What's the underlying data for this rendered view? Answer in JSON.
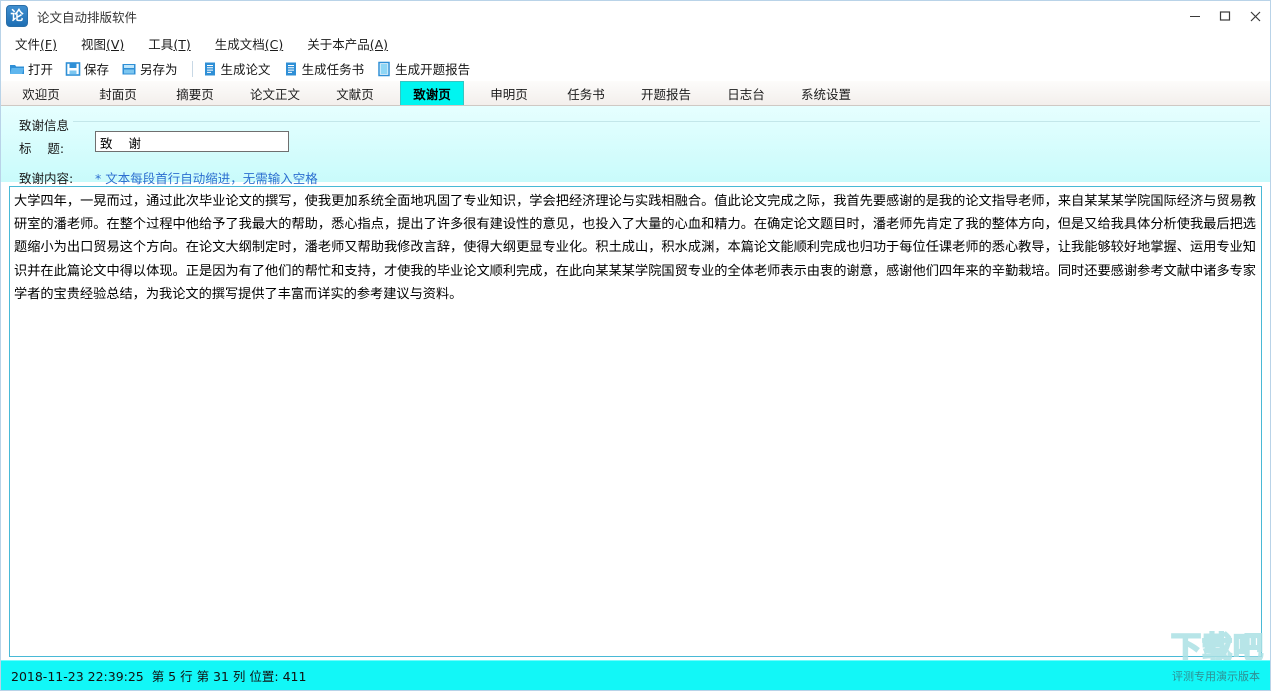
{
  "window": {
    "title": "论文自动排版软件",
    "icon": "app-logo-icon",
    "icon_glyph": "论",
    "controls": {
      "minimize": "minimize-icon",
      "maximize": "maximize-icon",
      "close": "close-icon"
    }
  },
  "menubar": {
    "items": [
      {
        "label": "文件(F)",
        "text": "文件",
        "mnemonic": "(F)"
      },
      {
        "label": "视图(V)",
        "text": "视图",
        "mnemonic": "(V)"
      },
      {
        "label": "工具(T)",
        "text": "工具",
        "mnemonic": "(T)"
      },
      {
        "label": "生成文档(C)",
        "text": "生成文档",
        "mnemonic": "(C)"
      },
      {
        "label": "关于本产品(A)",
        "text": "关于本产品",
        "mnemonic": "(A)"
      }
    ]
  },
  "toolbar": {
    "items": [
      {
        "label": "打开",
        "icon": "folder-open-icon"
      },
      {
        "label": "保存",
        "icon": "save-disk-icon"
      },
      {
        "label": "另存为",
        "icon": "save-as-icon"
      },
      {
        "label": "生成论文",
        "icon": "document-thesis-icon"
      },
      {
        "label": "生成任务书",
        "icon": "document-task-icon"
      },
      {
        "label": "生成开题报告",
        "icon": "document-report-icon"
      }
    ]
  },
  "tabs": {
    "active_index": 5,
    "items": [
      {
        "label": "欢迎页"
      },
      {
        "label": "封面页"
      },
      {
        "label": "摘要页"
      },
      {
        "label": "论文正文"
      },
      {
        "label": "文献页"
      },
      {
        "label": "致谢页"
      },
      {
        "label": "申明页"
      },
      {
        "label": "任务书"
      },
      {
        "label": "开题报告"
      },
      {
        "label": "日志台"
      },
      {
        "label": "系统设置"
      }
    ]
  },
  "form": {
    "group_label": "致谢信息",
    "title_label": "标    题:",
    "title_value": "致    谢",
    "title_placeholder": "",
    "content_label": "致谢内容:",
    "hint": "* 文本每段首行自动缩进，无需输入空格"
  },
  "editor": {
    "content": "大学四年，一晃而过，通过此次毕业论文的撰写，使我更加系统全面地巩固了专业知识，学会把经济理论与实践相融合。值此论文完成之际，我首先要感谢的是我的论文指导老师，来自某某某学院国际经济与贸易教研室的潘老师。在整个过程中他给予了我最大的帮助，悉心指点，提出了许多很有建设性的意见，也投入了大量的心血和精力。在确定论文题目时，潘老师先肯定了我的整体方向，但是又给我具体分析使我最后把选题缩小为出口贸易这个方向。在论文大纲制定时，潘老师又帮助我修改言辞，使得大纲更显专业化。积土成山，积水成渊，本篇论文能顺利完成也归功于每位任课老师的悉心教导，让我能够较好地掌握、运用专业知识并在此篇论文中得以体现。正是因为有了他们的帮忙和支持，才使我的毕业论文顺利完成，在此向某某某学院国贸专业的全体老师表示由衷的谢意，感谢他们四年来的辛勤栽培。同时还要感谢参考文献中诸多专家学者的宝贵经验总结，为我论文的撰写提供了丰富而详实的参考建议与资料。"
  },
  "statusbar": {
    "timestamp": "2018-11-23 22:39:25",
    "line_label": "第 5 行",
    "column_label": "第 31 列",
    "position_label": "位置: 411",
    "full_text": "2018-11-23 22:39:25  第 5 行 第 31 列 位置: 411",
    "trial_notice": "评测专用演示版本"
  },
  "watermark": {
    "text": "下载吧"
  },
  "colors": {
    "accent_cyan": "#00F5F0",
    "status_bar": "#12F7F7",
    "panel_bg_top": "#E6FFFF",
    "panel_bg_bottom": "#C9FBFB",
    "editor_border": "#49B9D6",
    "hint_blue": "#2D6FD0",
    "toolbar_icon_blue": "#1E7FD0"
  }
}
